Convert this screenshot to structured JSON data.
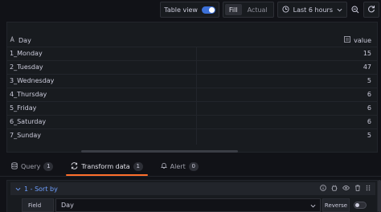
{
  "toolbar": {
    "table_view_label": "Table view",
    "table_view_on": true,
    "fill_label": "Fill",
    "actual_label": "Actual",
    "time_range": "Last 6 hours"
  },
  "table": {
    "columns": [
      "Day",
      "value"
    ],
    "rows": [
      {
        "day": "1_Monday",
        "value": "15"
      },
      {
        "day": "2_Tuesday",
        "value": "47"
      },
      {
        "day": "3_Wednesday",
        "value": "5"
      },
      {
        "day": "4_Thursday",
        "value": "6"
      },
      {
        "day": "5_Friday",
        "value": "6"
      },
      {
        "day": "6_Saturday",
        "value": "6"
      },
      {
        "day": "7_Sunday",
        "value": "5"
      }
    ]
  },
  "tabs": [
    {
      "label": "Query",
      "count": "1",
      "icon": "database-icon"
    },
    {
      "label": "Transform data",
      "count": "1",
      "icon": "transform-icon"
    },
    {
      "label": "Alert",
      "count": "0",
      "icon": "bell-icon"
    }
  ],
  "transformation": {
    "title": "1 - Sort by",
    "field_label": "Field",
    "field_value": "Day",
    "reverse_label": "Reverse",
    "reverse_on": false
  },
  "colors": {
    "background": "#111217",
    "panel": "#181b1f",
    "accent_blue": "#3d71d9",
    "link_blue": "#6e9fff",
    "active_tab_underline": "#ff6f2c"
  }
}
